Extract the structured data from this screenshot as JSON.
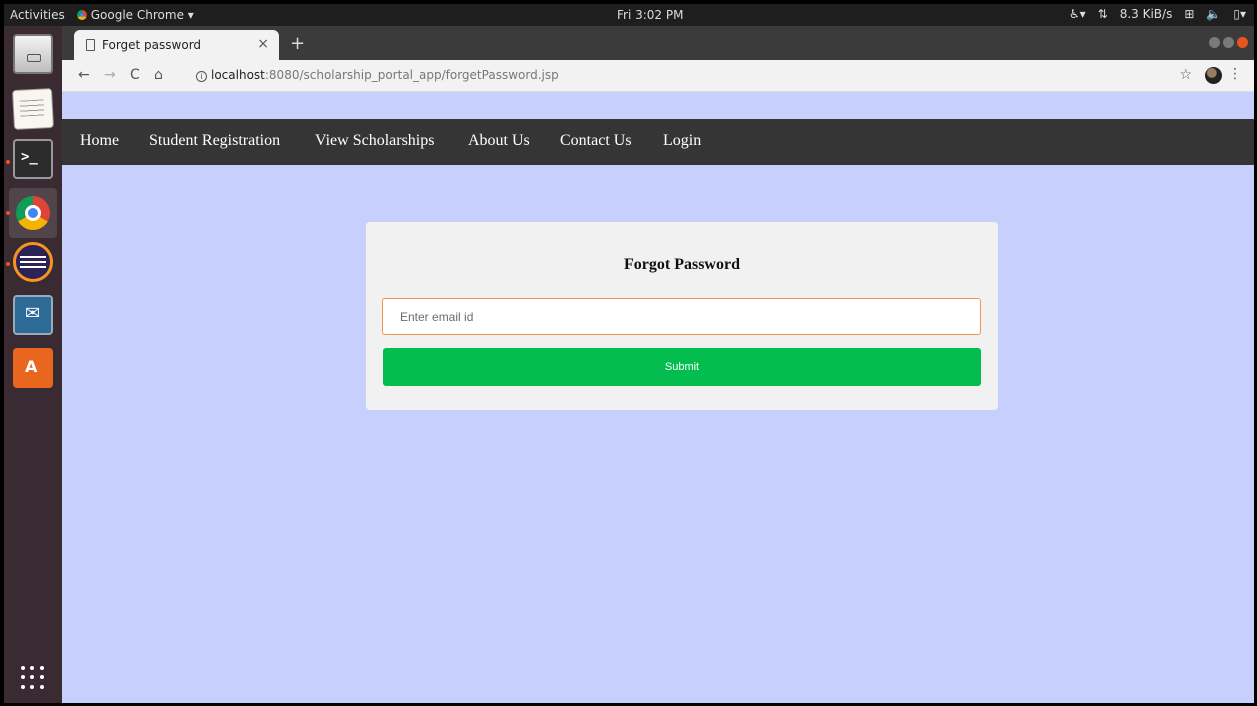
{
  "system_bar": {
    "activities": "Activities",
    "app_name": "Google Chrome ▾",
    "clock": "Fri 3:02 PM",
    "net_speed": "8.3 KiB/s"
  },
  "browser": {
    "tab_title": "Forget password",
    "tab_close": "×",
    "new_tab": "+",
    "url_host": "localhost",
    "url_path": ":8080/scholarship_portal_app/forgetPassword.jsp"
  },
  "navbar": {
    "links": [
      "Home",
      "Student Registration",
      "View Scholarships",
      "About Us",
      "Contact Us",
      "Login"
    ]
  },
  "form": {
    "title": "Forgot Password",
    "email_placeholder": "Enter email id",
    "email_value": "",
    "submit_label": "Submit"
  },
  "colors": {
    "page_bg": "#c7d0fd",
    "navbar_bg": "#353535",
    "card_bg": "#f1f1f1",
    "input_border": "#f29353",
    "submit_bg": "#04bd4f"
  }
}
